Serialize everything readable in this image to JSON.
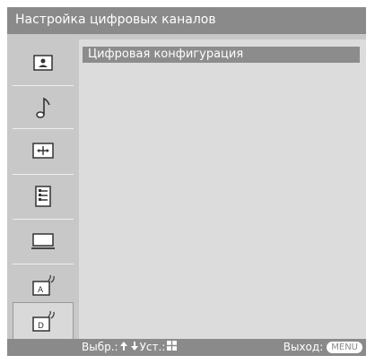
{
  "header": {
    "title": "Настройка цифровых каналов"
  },
  "sidebar": {
    "items": [
      {
        "icon": "picture-icon",
        "selected": false
      },
      {
        "icon": "sound-icon",
        "selected": false
      },
      {
        "icon": "screen-icon",
        "selected": false
      },
      {
        "icon": "setup-icon",
        "selected": false
      },
      {
        "icon": "pc-icon",
        "selected": false
      },
      {
        "icon": "analog-channel-icon",
        "selected": false
      },
      {
        "icon": "digital-channel-icon",
        "selected": true
      }
    ]
  },
  "main": {
    "items": [
      {
        "label": "Цифровая конфигурация",
        "selected": true
      }
    ]
  },
  "footer": {
    "select_label": "Выбр.:",
    "set_label": "Уст.:",
    "exit_label": "Выход:",
    "menu_button": "MENU"
  },
  "colors": {
    "title_bar": "#8a8a8a",
    "background": "#c8c8c8",
    "content": "#dcdcdc",
    "highlight": "#8c8c8c"
  }
}
